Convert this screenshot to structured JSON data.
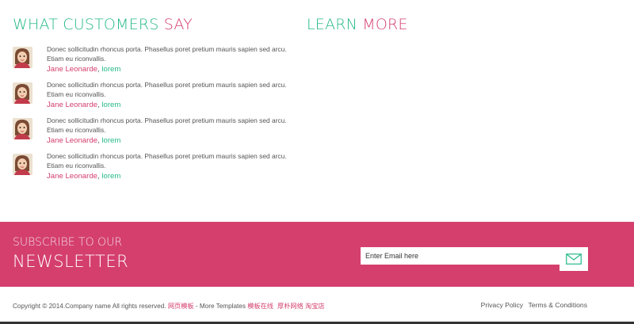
{
  "testimonials": {
    "title_main": "WHAT CUSTOMERS",
    "title_accent": "SAY",
    "items": [
      {
        "text": "Donec sollicitudin rhoncus porta. Phasellus poret pretium mauris sapien sed arcu. Etiam eu riconvallis.",
        "author": "Jane Leonarde",
        "company": "lorem"
      },
      {
        "text": "Donec sollicitudin rhoncus porta. Phasellus poret pretium mauris sapien sed arcu. Etiam eu riconvallis.",
        "author": "Jane Leonarde",
        "company": "lorem"
      },
      {
        "text": "Donec sollicitudin rhoncus porta. Phasellus poret pretium mauris sapien sed arcu. Etiam eu riconvallis.",
        "author": "Jane Leonarde",
        "company": "lorem"
      },
      {
        "text": "Donec sollicitudin rhoncus porta. Phasellus poret pretium mauris sapien sed arcu. Etiam eu riconvallis.",
        "author": "Jane Leonarde",
        "company": "lorem"
      }
    ]
  },
  "learn": {
    "title_main": "LEARN",
    "title_accent": "MORE"
  },
  "subscribe": {
    "line1": "SUBSCRIBE TO OUR",
    "line2": "NEWSLETTER",
    "email_placeholder": "Enter Email here",
    "send_icon": "envelope-icon"
  },
  "footer": {
    "copyright": "Copyright © 2014.Company name All rights reserved.",
    "link1": "网页模板",
    "more_templates": " - More Templates ",
    "link2": "模板在线",
    "link3": "厚朴网络 淘宝店",
    "privacy": "Privacy Policy",
    "terms": "Terms & Conditions"
  },
  "colors": {
    "pink": "#d43f6e",
    "green": "#26b98a",
    "text": "#555555"
  }
}
